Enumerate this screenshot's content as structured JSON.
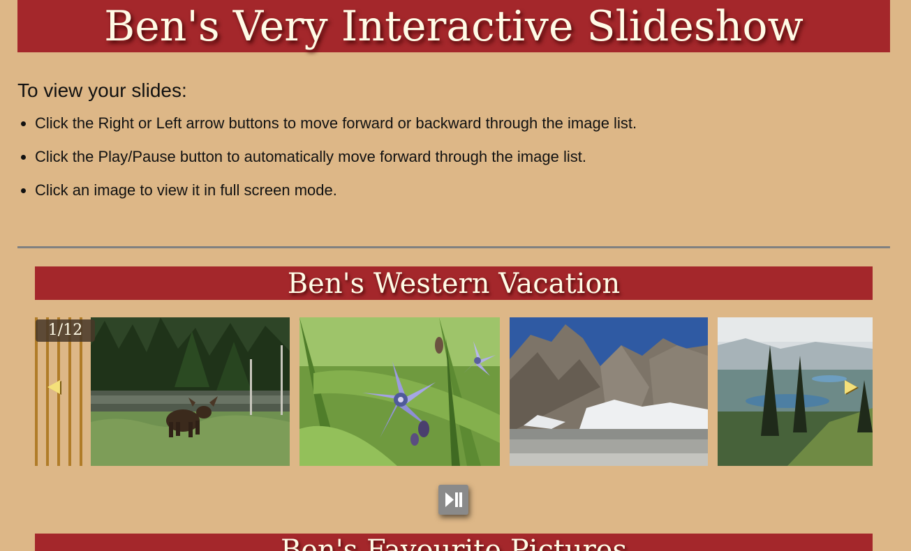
{
  "header": {
    "title": "Ben's Very Interactive Slideshow"
  },
  "instructions": {
    "heading": "To view your slides:",
    "items": [
      "Click the Right or Left arrow buttons to move forward or backward through the image list.",
      "Click the Play/Pause button to automatically move forward through the image list.",
      "Click an image to view it in full screen mode."
    ]
  },
  "slideshows": [
    {
      "title": "Ben's Western Vacation",
      "counter": "1/12",
      "slides": [
        {
          "subject": "moose-in-meadow"
        },
        {
          "subject": "purple-wildflower"
        },
        {
          "subject": "mountain-lake-cliffs"
        },
        {
          "subject": "alpine-lakes-view"
        }
      ],
      "prev_icon": "left-arrow-icon",
      "next_icon": "right-arrow-icon",
      "play_icon": "play-pause-icon"
    },
    {
      "title": "Ben's Favourite Pictures"
    }
  ],
  "colors": {
    "background": "#ddb787",
    "header_bg": "#a4272b",
    "header_text": "#fffbe6",
    "arrow": "#f4e07a",
    "divider": "#808080"
  }
}
